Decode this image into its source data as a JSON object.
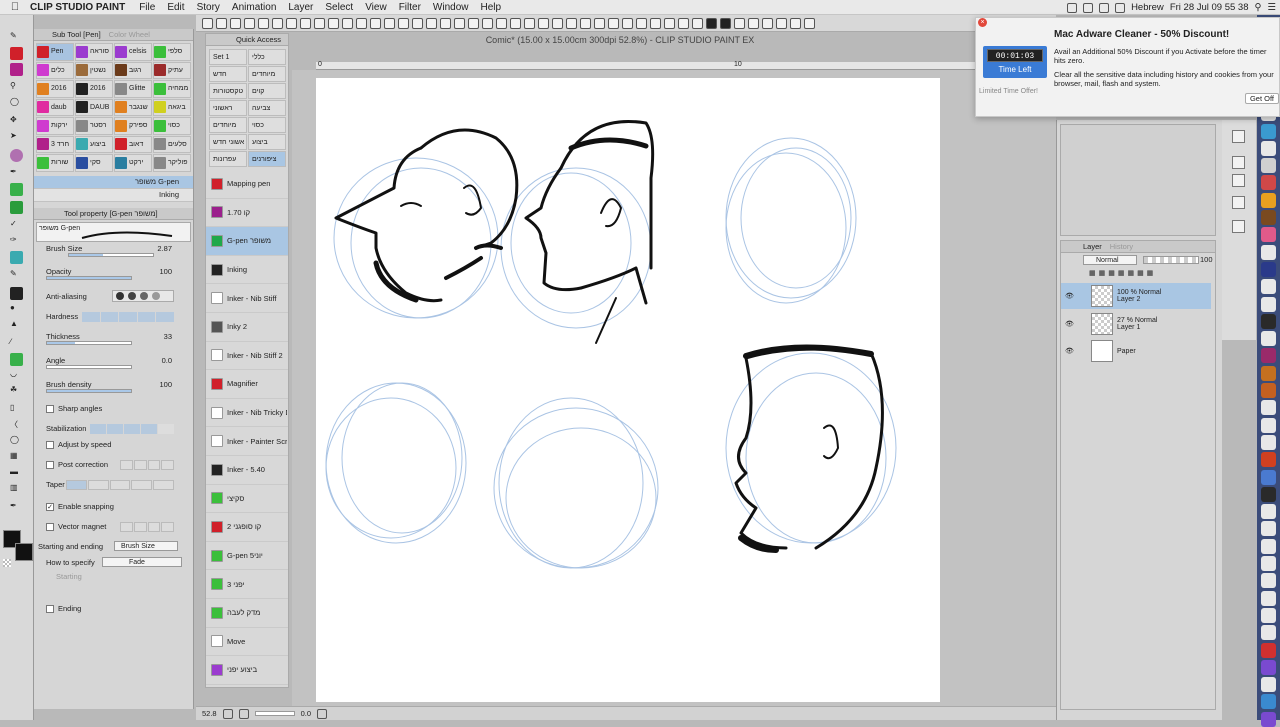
{
  "menubar": {
    "app_name": "CLIP STUDIO PAINT",
    "items": [
      "File",
      "Edit",
      "Story",
      "Animation",
      "Layer",
      "Select",
      "View",
      "Filter",
      "Window",
      "Help"
    ],
    "input_source": "Hebrew",
    "clock": "Fri 28 Jul  09 55 38"
  },
  "document": {
    "title": "Comic* (15.00 x 15.00cm 300dpi 52.8%)  - CLIP STUDIO PAINT EX",
    "ruler_ticks": [
      "0",
      "10"
    ]
  },
  "subtool_panel": {
    "tab_active": "Sub Tool [Pen]",
    "tab_inactive": "Color Wheel",
    "brushes": [
      [
        "Pen",
        "סוראה",
        "celsis",
        "סלפי"
      ],
      [
        "כלים",
        "נשטין",
        "רגוב",
        "עתיק"
      ],
      [
        "2016",
        "2016",
        "Glitte",
        "ממחיה"
      ],
      [
        "daub",
        "DAUB",
        "שנגבר",
        "ביגאה"
      ],
      [
        "ירקות",
        "רסטר",
        "ספירק",
        "כסוי"
      ],
      [
        "חרד 3",
        "ביצוע",
        "דאוב",
        "סלעים"
      ],
      [
        "שורות",
        "סקי",
        "ירקט",
        "פוליקר"
      ]
    ],
    "list_items": [
      "משופר G-pen",
      "Inking"
    ],
    "selected_list_item": "משופר G-pen"
  },
  "tool_property": {
    "header": "Tool property [G-pen משופר]",
    "preview_label": "משופר G-pen",
    "brush_size_label": "Brush Size",
    "brush_size_value": "2.87",
    "opacity_label": "Opacity",
    "opacity_value": "100",
    "anti_aliasing_label": "Anti-aliasing",
    "hardness_label": "Hardness",
    "thickness_label": "Thickness",
    "thickness_value": "33",
    "angle_label": "Angle",
    "angle_value": "0.0",
    "brush_density_label": "Brush density",
    "brush_density_value": "100",
    "sharp_angles_label": "Sharp angles",
    "stabilization_label": "Stabilization",
    "adjust_speed_label": "Adjust by speed",
    "post_correction_label": "Post correction",
    "taper_label": "Taper",
    "enable_snapping_label": "Enable snapping",
    "vector_magnet_label": "Vector magnet",
    "starting_ending_label": "Starting and ending",
    "starting_ending_value": "Brush Size",
    "how_to_specify_label": "How to specify",
    "how_to_specify_value": "Fade",
    "starting_label": "Starting",
    "ending_label": "Ending"
  },
  "quick_access": {
    "title": "Quick Access",
    "sets": [
      [
        "Set 1",
        "כללי"
      ],
      [
        "חדש",
        "מיוחדים"
      ],
      [
        "טקסטורות",
        "קוים"
      ],
      [
        "ראשוני",
        "צביעה"
      ],
      [
        "מיוחדים",
        "כסוי"
      ],
      [
        "אשוני חדש",
        "ביצוע"
      ],
      [
        "עפרונות",
        "ציפורנים"
      ]
    ],
    "items": [
      {
        "label": "Mapping pen",
        "color": "#d0202a"
      },
      {
        "label": "1.70 קו",
        "color": "#9b1f8c"
      },
      {
        "label": "G-pen משופר",
        "color": "#1fa84a"
      },
      {
        "label": "Inking",
        "color": "#222222"
      },
      {
        "label": "Inker - Nib Stiff",
        "color": "#ffffff"
      },
      {
        "label": "Inky 2",
        "color": "#555555"
      },
      {
        "label": "Inker - Nib Stiff 2",
        "color": "#ffffff"
      },
      {
        "label": "Magnifier",
        "color": "#d0202a"
      },
      {
        "label": "Inker - Nib Tricky Dick",
        "color": "#ffffff"
      },
      {
        "label": "Inker - Painter Scratchboard Tool",
        "color": "#ffffff"
      },
      {
        "label": "Inker - 5.40",
        "color": "#222222"
      },
      {
        "label": "סקיצי",
        "color": "#3bbf3b"
      },
      {
        "label": "קו סופגני 2",
        "color": "#d0202a"
      },
      {
        "label": "G-pen 5יוני",
        "color": "#3bbf3b"
      },
      {
        "label": "יפני 3",
        "color": "#3bbf3b"
      },
      {
        "label": "מדק לעבה",
        "color": "#3bbf3b"
      },
      {
        "label": "Move",
        "color": "#ffffff"
      },
      {
        "label": "ביצוע יפני",
        "color": "#9b3bcf"
      }
    ],
    "selected_item": "G-pen משופר"
  },
  "layer_panel": {
    "tab_active": "Layer",
    "tab_inactive": "History",
    "blend_mode": "Normal",
    "opacity": "100",
    "layers": [
      {
        "opacity_mode": "100 % Normal",
        "name": "Layer 2"
      },
      {
        "opacity_mode": "27 % Normal",
        "name": "Layer 1"
      },
      {
        "opacity_mode": "",
        "name": "Paper"
      }
    ],
    "selected_layer": "Layer 2"
  },
  "notification": {
    "title": "Mac Adware Cleaner - 50% Discount!",
    "line1": "Avail an Additional 50% Discount if you Activate before the timer hits zero.",
    "line2": "Clear all the sensitive data including history and cookies from your browser, mail, flash and system.",
    "timer": "00:01:03",
    "timer_label": "Time Left",
    "limited": "Limited Time Offer!",
    "button": "Get Off"
  },
  "statusbar": {
    "zoom": "52.8",
    "rotation": "0.0"
  },
  "colors": {
    "accent_blue": "#a9c6e3",
    "dock_bg": "#3b4c7a",
    "notif_button_blue": "#3a7bd5",
    "sketch_blue": "#aac4e4",
    "ink": "#111111"
  }
}
